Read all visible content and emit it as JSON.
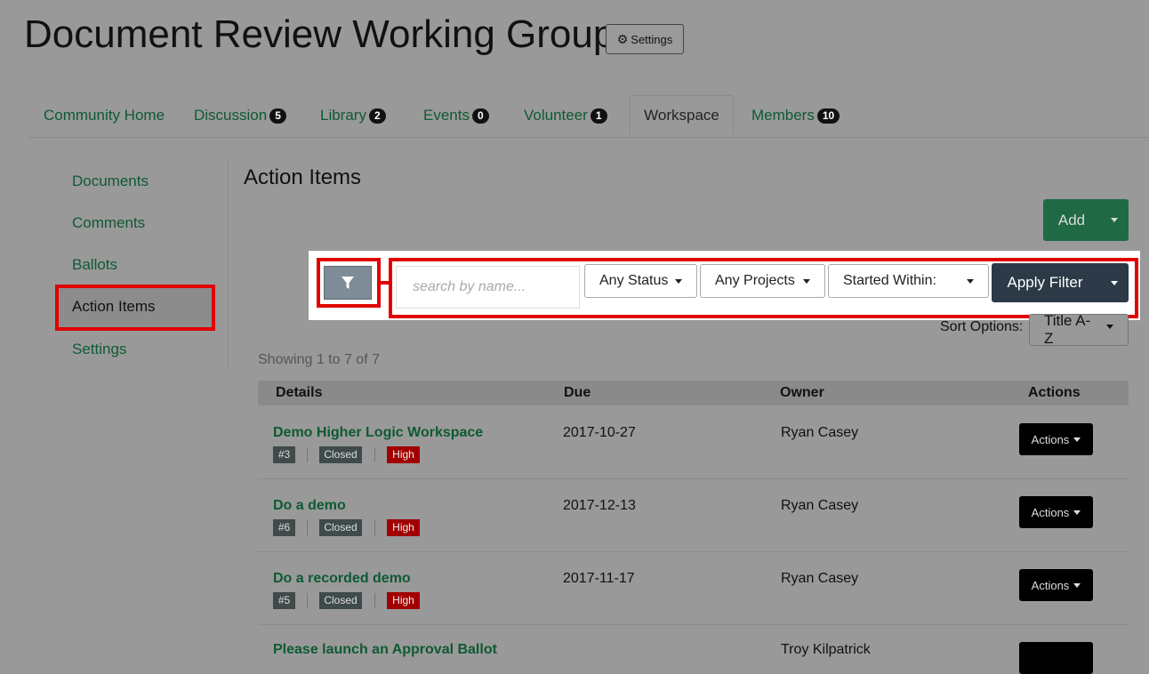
{
  "header": {
    "title": "Document Review Working Group",
    "settings_label": "Settings"
  },
  "tabs": [
    {
      "label": "Community Home"
    },
    {
      "label": "Discussion",
      "badge": "5"
    },
    {
      "label": "Library",
      "badge": "2"
    },
    {
      "label": "Events",
      "badge": "0"
    },
    {
      "label": "Volunteer",
      "badge": "1"
    },
    {
      "label": "Workspace",
      "active": true
    },
    {
      "label": "Members",
      "badge": "10"
    }
  ],
  "sidebar": {
    "items": [
      {
        "label": "Documents"
      },
      {
        "label": "Comments"
      },
      {
        "label": "Ballots"
      },
      {
        "label": "Action Items",
        "active": true
      },
      {
        "label": "Settings"
      }
    ]
  },
  "main": {
    "title": "Action Items",
    "add_label": "Add",
    "filter": {
      "search_placeholder": "search by name...",
      "status": "Any Status",
      "projects": "Any Projects",
      "started": "Started Within:",
      "apply_label": "Apply Filter"
    },
    "sort": {
      "label": "Sort Options:",
      "value": "Title A-Z"
    },
    "showing": "Showing 1 to 7 of 7",
    "table": {
      "headers": [
        "Details",
        "Due",
        "Owner",
        "Actions"
      ],
      "rows": [
        {
          "title": "Demo Higher Logic Workspace",
          "id": "#3",
          "status": "Closed",
          "priority": "High",
          "due": "2017-10-27",
          "owner": "Ryan Casey",
          "action_label": "Actions"
        },
        {
          "title": "Do a demo",
          "id": "#6",
          "status": "Closed",
          "priority": "High",
          "due": "2017-12-13",
          "owner": "Ryan Casey",
          "action_label": "Actions"
        },
        {
          "title": "Do a recorded demo",
          "id": "#5",
          "status": "Closed",
          "priority": "High",
          "due": "2017-11-17",
          "owner": "Ryan Casey",
          "action_label": "Actions"
        },
        {
          "title": "Please launch an Approval Ballot",
          "owner": "Troy Kilpatrick"
        }
      ]
    }
  },
  "colors": {
    "accent_green": "#0e5a33",
    "highlight_red": "#e00000",
    "priority_high": "#a10000"
  },
  "icons": {
    "settings": "gear-icon",
    "filter": "filter-icon",
    "dropdown": "caret-down-icon"
  }
}
